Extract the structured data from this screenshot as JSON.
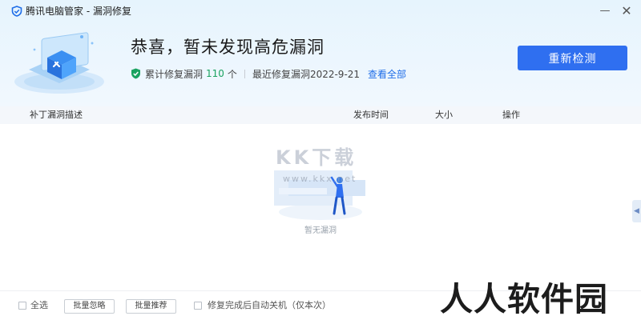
{
  "window": {
    "title": "腾讯电脑管家 - 漏洞修复",
    "minimize_glyph": "—",
    "close_glyph": "✕"
  },
  "hero": {
    "headline": "恭喜，暂未发现高危漏洞",
    "fixed_label": "累计修复漏洞",
    "fixed_count": "110",
    "fixed_unit": "个",
    "last_fix_label": "最近修复漏洞2022-9-21",
    "view_all": "查看全部",
    "recheck_button": "重新检测"
  },
  "table": {
    "columns": [
      "补丁漏洞描述",
      "发布时间",
      "大小",
      "操作"
    ]
  },
  "empty": {
    "text": "暂无漏洞"
  },
  "watermark": {
    "kk": "KK下载",
    "url": "www.kkx.net",
    "corner": "人人软件园"
  },
  "footer": {
    "select_all": "全选",
    "batch_ignore": "批量忽略",
    "batch_recommend": "批量推荐",
    "auto_shutdown": "修复完成后自动关机（仅本次）"
  },
  "colors": {
    "accent": "#2f6ff0",
    "success": "#1aa260",
    "link": "#1e6de8"
  }
}
